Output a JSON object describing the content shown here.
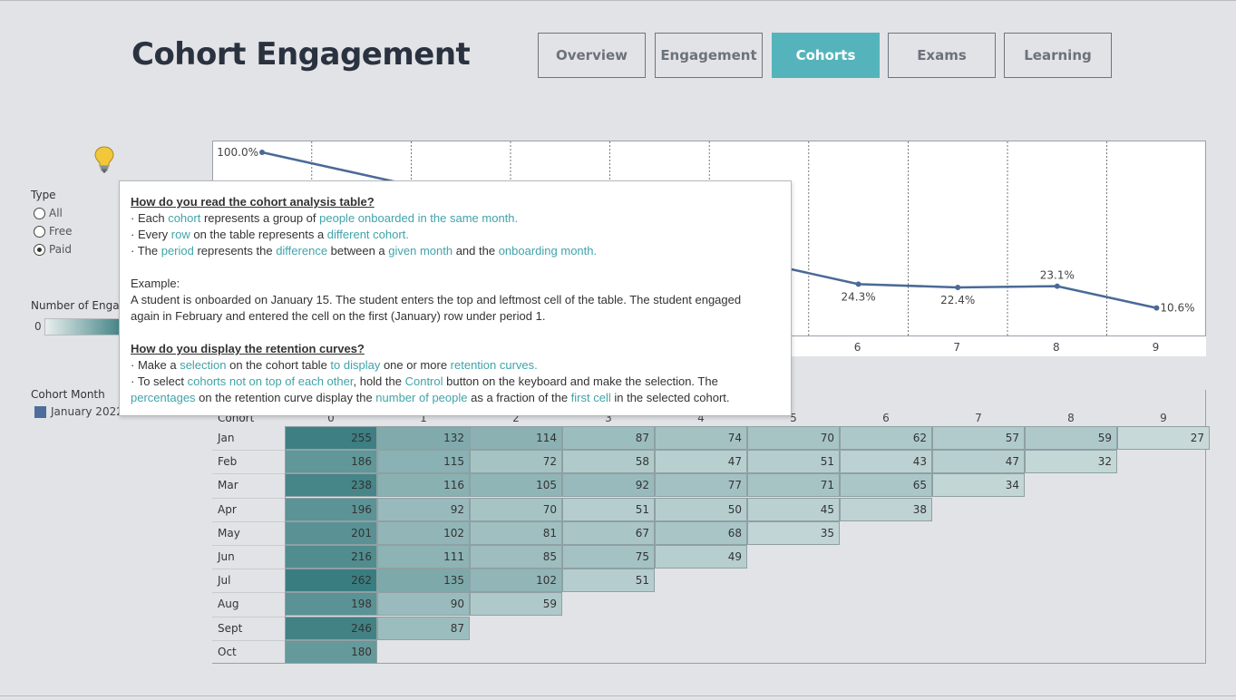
{
  "page_title": "Cohort Engagement",
  "nav": [
    {
      "label": "Overview",
      "active": false
    },
    {
      "label": "Engagement",
      "active": false
    },
    {
      "label": "Cohorts",
      "active": true
    },
    {
      "label": "Exams",
      "active": false
    },
    {
      "label": "Learning",
      "active": false
    }
  ],
  "icons": {
    "help": "lightbulb-icon"
  },
  "colors": {
    "accent": "#55b4bb",
    "line": "#4a6a96",
    "cell_dark": "#3a7d80",
    "cell_light": "#e8eeee"
  },
  "filters": {
    "type_title": "Type",
    "type_options": [
      {
        "label": "All",
        "checked": false
      },
      {
        "label": "Free",
        "checked": false
      },
      {
        "label": "Paid",
        "checked": true
      }
    ],
    "engagement_title": "Number of Engag",
    "engagement_min": "0",
    "cohort_month_title": "Cohort Month",
    "cohort_month_value": "January 2022"
  },
  "chart_data": {
    "type": "line",
    "x": [
      0,
      6,
      7,
      8,
      9
    ],
    "y": [
      100.0,
      24.3,
      22.4,
      23.1,
      10.6
    ],
    "data_labels": [
      "100.0%",
      "24.3%",
      "22.4%",
      "23.1%",
      "10.6%"
    ],
    "tick_labels": [
      "6",
      "7",
      "8",
      "9"
    ],
    "grid": "vertical dashed"
  },
  "table": {
    "header": "Cohort",
    "periods": [
      "0",
      "1",
      "2",
      "3",
      "4",
      "5",
      "6",
      "7",
      "8",
      "9"
    ],
    "rows": [
      {
        "cohort": "Jan",
        "values": [
          255,
          132,
          114,
          87,
          74,
          70,
          62,
          57,
          59,
          27
        ]
      },
      {
        "cohort": "Feb",
        "values": [
          186,
          115,
          72,
          58,
          47,
          51,
          43,
          47,
          32
        ]
      },
      {
        "cohort": "Mar",
        "values": [
          238,
          116,
          105,
          92,
          77,
          71,
          65,
          34
        ]
      },
      {
        "cohort": "Apr",
        "values": [
          196,
          92,
          70,
          51,
          50,
          45,
          38
        ]
      },
      {
        "cohort": "May",
        "values": [
          201,
          102,
          81,
          67,
          68,
          35
        ]
      },
      {
        "cohort": "Jun",
        "values": [
          216,
          111,
          85,
          75,
          49
        ]
      },
      {
        "cohort": "Jul",
        "values": [
          262,
          135,
          102,
          51
        ]
      },
      {
        "cohort": "Aug",
        "values": [
          198,
          90,
          59
        ]
      },
      {
        "cohort": "Sept",
        "values": [
          246,
          87
        ]
      },
      {
        "cohort": "Oct",
        "values": [
          180
        ]
      }
    ]
  },
  "tooltip": {
    "read_title": "How do you read the cohort analysis table?",
    "read_l1": [
      "· Each ",
      "cohort",
      " represents a group of ",
      "people onboarded in the same month."
    ],
    "read_l2": [
      "· Every ",
      "row",
      " on the table represents a ",
      "different cohort."
    ],
    "read_l3": [
      "· The ",
      "period",
      " represents the ",
      "difference",
      " between a ",
      "given month",
      " and the ",
      "onboarding month."
    ],
    "example_title": "Example:",
    "example_l1": "A student is onboarded on January 15. The student enters the top and leftmost cell of the table. The student engaged",
    "example_l2": "again in February and entered the cell on the first (January) row under period 1.",
    "display_title": "How do you display the retention curves?",
    "disp_l1": [
      "· Make a ",
      "selection",
      " on the cohort table ",
      "to display",
      " one or more ",
      "retention curves."
    ],
    "disp_l2": [
      "· To select ",
      "cohorts not on top of each other",
      ", hold the ",
      "Control",
      " button on the keyboard and make the selection. The"
    ],
    "disp_l3": [
      "percentages",
      " on the retention curve display the ",
      "number of people",
      " as a fraction of the ",
      "first cell",
      " in the selected cohort."
    ]
  }
}
